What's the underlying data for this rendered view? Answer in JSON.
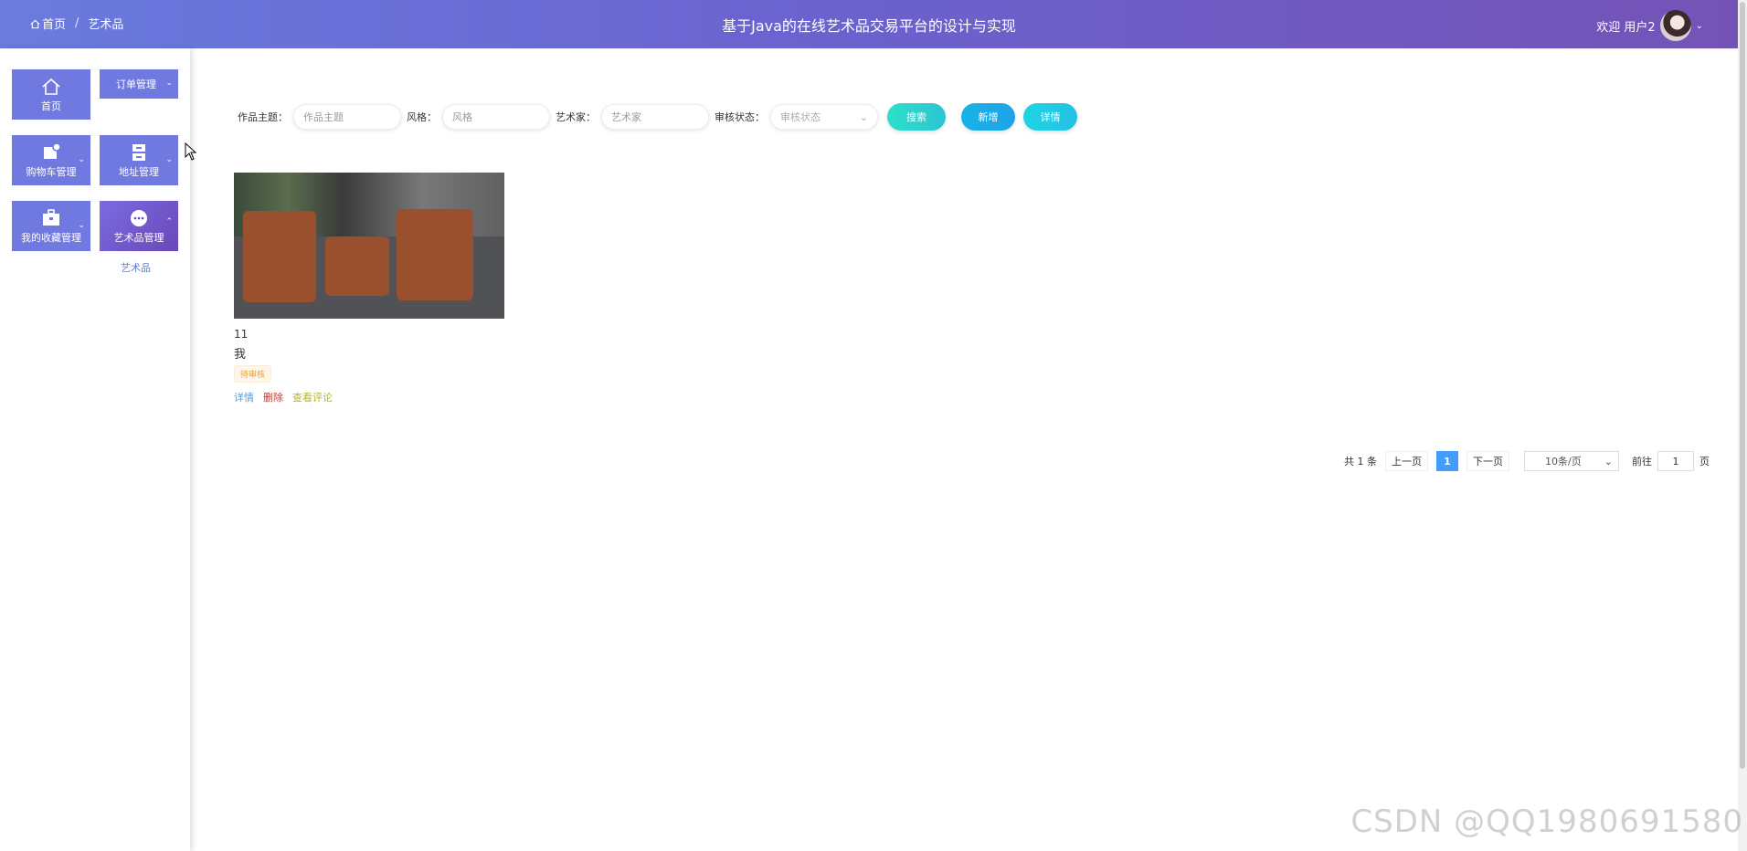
{
  "header": {
    "breadcrumb": [
      "首页",
      "艺术品"
    ],
    "breadcrumb_sep": "/",
    "title": "基于Java的在线艺术品交易平台的设计与实现",
    "user": "欢迎 用户2"
  },
  "sidebar": {
    "tiles": [
      {
        "label": "首页",
        "icon": "home-icon"
      },
      {
        "label": "订单管理",
        "icon": "none"
      },
      {
        "label": "购物车管理",
        "icon": "cart-icon"
      },
      {
        "label": "地址管理",
        "icon": "address-icon"
      },
      {
        "label": "我的收藏管理",
        "icon": "briefcase-icon"
      },
      {
        "label": "艺术品管理",
        "icon": "chat-icon"
      }
    ],
    "subitem": "艺术品"
  },
  "search": {
    "topic_label": "作品主题：",
    "topic_placeholder": "作品主题",
    "style_label": "风格：",
    "style_placeholder": "风格",
    "artist_label": "艺术家：",
    "artist_placeholder": "艺术家",
    "status_label": "审核状态：",
    "status_placeholder": "审核状态",
    "search_btn": "搜索",
    "add_btn": "新增",
    "delete_btn": "详情"
  },
  "card": {
    "number": "11",
    "author": "我",
    "tag": "待审核",
    "actions": [
      "详情",
      "删除",
      "查看评论"
    ]
  },
  "pager": {
    "total": "共 1 条",
    "prev": "上一页",
    "current": "1",
    "next": "下一页",
    "size": "10条/页",
    "goto": "前往",
    "page_value": "1",
    "page_unit": "页"
  },
  "watermark": "CSDN @QQ1980691580",
  "colors": {
    "accent": "#6f79e0",
    "header_start": "#6a7bde",
    "header_end": "#7453b6",
    "primary": "#409eff"
  }
}
